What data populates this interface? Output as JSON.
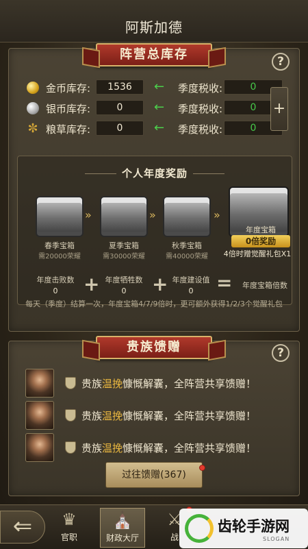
{
  "header": {
    "title": "阿斯加德"
  },
  "inventory": {
    "ribbon": "阵营总库存",
    "help": "?",
    "add": "+",
    "rows": [
      {
        "icon": "gold-coin-icon",
        "label": "金币库存:",
        "value": "1536",
        "tax_label": "季度税收:",
        "tax_value": "0"
      },
      {
        "icon": "silver-coin-icon",
        "label": "银币库存:",
        "value": "0",
        "tax_label": "季度税收:",
        "tax_value": "0"
      },
      {
        "icon": "grain-icon",
        "label": "粮草库存:",
        "value": "0",
        "tax_label": "季度税收:",
        "tax_value": "0"
      }
    ]
  },
  "annual_reward": {
    "title": "个人年度奖励",
    "chests": [
      {
        "name": "春季宝箱",
        "req": "需20000荣耀"
      },
      {
        "name": "夏季宝箱",
        "req": "需30000荣耀"
      },
      {
        "name": "秋季宝箱",
        "req": "需40000荣耀"
      }
    ],
    "big_chest": {
      "name": "年度宝箱",
      "bonus": "0倍奖励",
      "desc": "4倍时赠觉醒礼包X1"
    },
    "stats": [
      {
        "label": "年度击败数",
        "value": "0"
      },
      {
        "label": "年度牺牲数",
        "value": "0"
      },
      {
        "label": "年度建设值",
        "value": "0"
      }
    ],
    "result_label": "年度宝箱倍数",
    "footnote": "每天（季度）结算一次，年度宝箱4/7/9倍时，更可额外获得1/2/3个觉醒礼包"
  },
  "noble_gift": {
    "ribbon": "贵族馈赠",
    "help": "?",
    "entries": [
      {
        "prefix": "贵族",
        "name": "温挽",
        "suffix": "慷慨解囊，全阵营共享馈赠！"
      },
      {
        "prefix": "贵族",
        "name": "温挽",
        "suffix": "慷慨解囊，全阵营共享馈赠！"
      },
      {
        "prefix": "贵族",
        "name": "温挽",
        "suffix": "慷慨解囊，全阵营共享馈赠！"
      }
    ],
    "history_button": "过往馈赠(367)"
  },
  "nav": {
    "items": [
      {
        "label": "官职",
        "icon": "crown-icon"
      },
      {
        "label": "财政大厅",
        "icon": "hall-icon"
      },
      {
        "label": "战",
        "icon": "battle-icon"
      }
    ]
  },
  "watermark": {
    "name": "齿轮手游网",
    "slogan": "SLOGAN"
  }
}
